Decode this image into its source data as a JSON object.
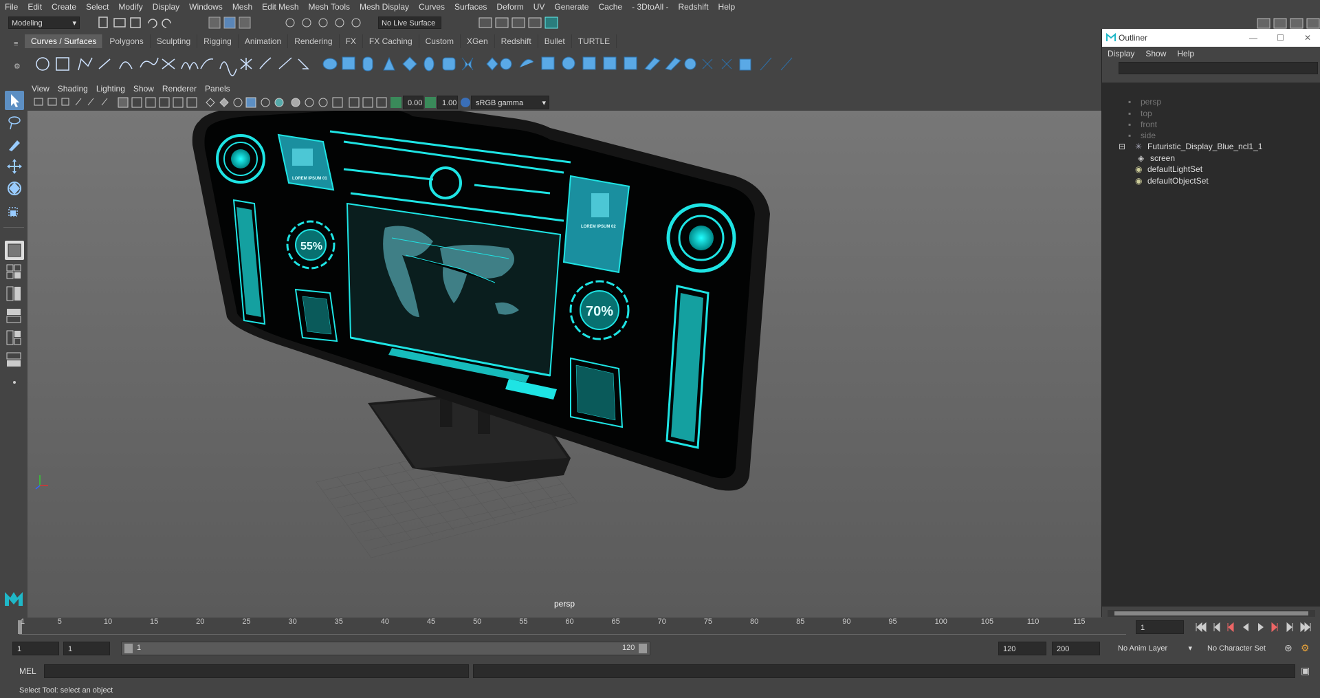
{
  "menubar": [
    "File",
    "Edit",
    "Create",
    "Select",
    "Modify",
    "Display",
    "Windows",
    "Mesh",
    "Edit Mesh",
    "Mesh Tools",
    "Mesh Display",
    "Curves",
    "Surfaces",
    "Deform",
    "UV",
    "Generate",
    "Cache",
    "- 3DtoAll -",
    "Redshift",
    "Help"
  ],
  "status": {
    "mode": "Modeling",
    "live_surface": "No Live Surface"
  },
  "shelf_tabs": [
    "Curves / Surfaces",
    "Polygons",
    "Sculpting",
    "Rigging",
    "Animation",
    "Rendering",
    "FX",
    "FX Caching",
    "Custom",
    "XGen",
    "Redshift",
    "Bullet",
    "TURTLE"
  ],
  "panel_menu": [
    "View",
    "Shading",
    "Lighting",
    "Show",
    "Renderer",
    "Panels"
  ],
  "view_toolbar": {
    "exposure": "0.00",
    "gamma": "1.00",
    "color_space": "sRGB gamma"
  },
  "viewport": {
    "camera_label": "persp",
    "hud_55": "55%",
    "hud_70": "70%",
    "screen_text_1": "LOREM IPSUM 01",
    "screen_text_2": "LOREM IPSUM 02"
  },
  "outliner": {
    "title": "Outliner",
    "menu": [
      "Display",
      "Show",
      "Help"
    ],
    "items": [
      {
        "label": "persp",
        "type": "camera"
      },
      {
        "label": "top",
        "type": "camera"
      },
      {
        "label": "front",
        "type": "camera"
      },
      {
        "label": "side",
        "type": "camera"
      },
      {
        "label": "Futuristic_Display_Blue_ncl1_1",
        "type": "group"
      },
      {
        "label": "screen",
        "type": "mesh"
      },
      {
        "label": "defaultLightSet",
        "type": "set"
      },
      {
        "label": "defaultObjectSet",
        "type": "set"
      }
    ]
  },
  "timeline": {
    "ticks": [
      "1",
      "5",
      "10",
      "15",
      "20",
      "25",
      "30",
      "35",
      "40",
      "45",
      "50",
      "55",
      "60",
      "65",
      "70",
      "75",
      "80",
      "85",
      "90",
      "95",
      "100",
      "105",
      "110",
      "115"
    ],
    "current_frame": "1"
  },
  "range": {
    "start": "1",
    "playback_start": "1",
    "range_start_label": "1",
    "range_end_label": "120",
    "playback_end": "120",
    "end": "200",
    "anim_layer": "No Anim Layer",
    "character_set": "No Character Set"
  },
  "cmdline": {
    "label": "MEL"
  },
  "helpline": {
    "text": "Select Tool: select an object"
  },
  "colors": {
    "accent": "#1ee4e4",
    "bg": "#444444",
    "viewport": "#6e6e6e",
    "panel_dark": "#2b2b2b"
  }
}
